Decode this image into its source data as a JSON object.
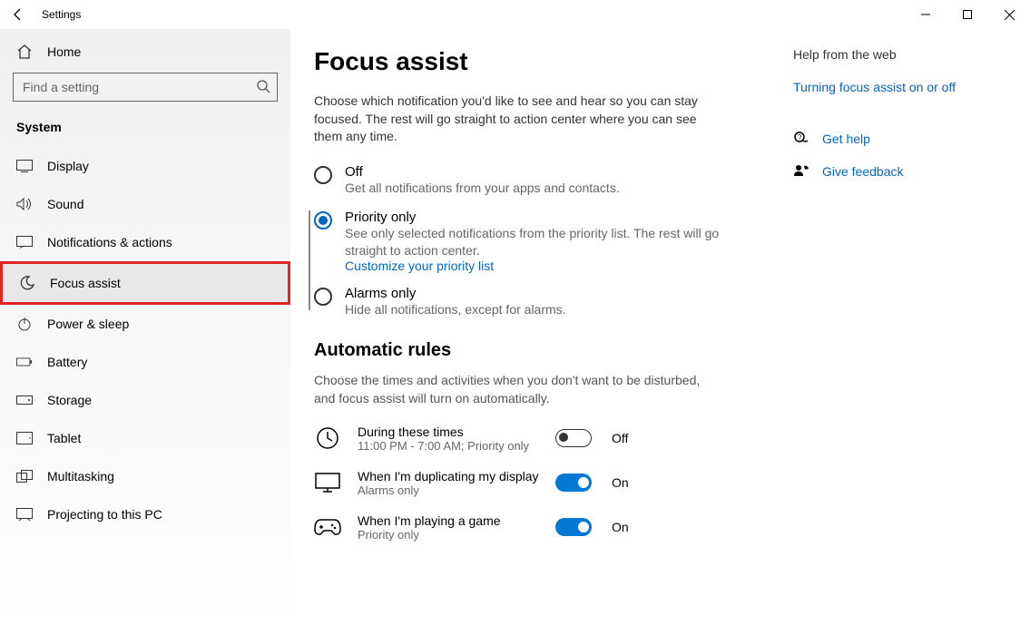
{
  "titlebar": {
    "title": "Settings"
  },
  "sidebar": {
    "home": "Home",
    "search_placeholder": "Find a setting",
    "section": "System",
    "items": [
      {
        "label": "Display"
      },
      {
        "label": "Sound"
      },
      {
        "label": "Notifications & actions"
      },
      {
        "label": "Focus assist"
      },
      {
        "label": "Power & sleep"
      },
      {
        "label": "Battery"
      },
      {
        "label": "Storage"
      },
      {
        "label": "Tablet"
      },
      {
        "label": "Multitasking"
      },
      {
        "label": "Projecting to this PC"
      }
    ]
  },
  "page": {
    "title": "Focus assist",
    "description": "Choose which notification you'd like to see and hear so you can stay focused. The rest will go straight to action center where you can see them any time.",
    "radios": {
      "off": {
        "title": "Off",
        "sub": "Get all notifications from your apps and contacts."
      },
      "priority": {
        "title": "Priority only",
        "sub": "See only selected notifications from the priority list. The rest will go straight to action center.",
        "link": "Customize your priority list"
      },
      "alarms": {
        "title": "Alarms only",
        "sub": "Hide all notifications, except for alarms."
      }
    },
    "rules_heading": "Automatic rules",
    "rules_desc": "Choose the times and activities when you don't want to be disturbed, and focus assist will turn on automatically.",
    "rules": {
      "times": {
        "title": "During these times",
        "sub": "11:00 PM - 7:00 AM; Priority only",
        "state": "Off"
      },
      "display": {
        "title": "When I'm duplicating my display",
        "sub": "Alarms only",
        "state": "On"
      },
      "game": {
        "title": "When I'm playing a game",
        "sub": "Priority only",
        "state": "On"
      }
    }
  },
  "right": {
    "heading": "Help from the web",
    "link1": "Turning focus assist on or off",
    "gethelp": "Get help",
    "feedback": "Give feedback"
  }
}
